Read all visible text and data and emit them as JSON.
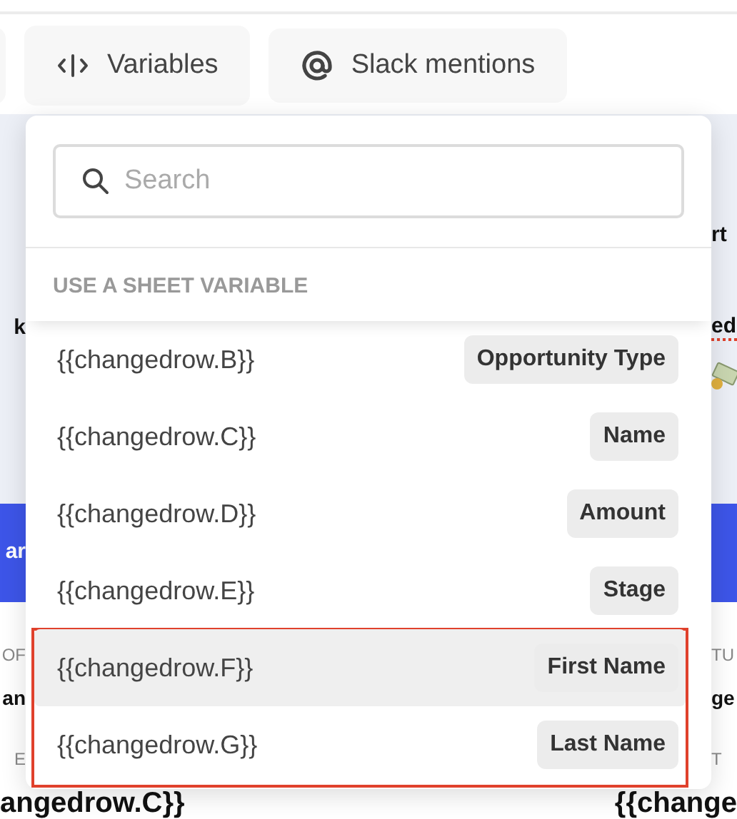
{
  "toolbar": {
    "buttons": [
      {
        "label": "Variables",
        "kind": "code"
      },
      {
        "label": "Slack mentions",
        "kind": "mention"
      }
    ]
  },
  "backdrop": {
    "rows": [
      {
        "kind": "heading",
        "left": "",
        "right": "rt"
      },
      {
        "kind": "heading",
        "left": "k",
        "right": "ed"
      },
      {
        "kind": "image",
        "left": "",
        "right": ""
      },
      {
        "kind": "band",
        "left": "ar",
        "right": ""
      },
      {
        "kind": "label",
        "left": "OF",
        "right": "TU"
      },
      {
        "kind": "value",
        "left": "an",
        "right": "ge"
      },
      {
        "kind": "label",
        "left": "E",
        "right": "T"
      },
      {
        "kind": "footer",
        "left": "angedrow.C}}",
        "right": "{{change"
      }
    ]
  },
  "menu": {
    "search": {
      "placeholder": "Search"
    },
    "section_title": "USE A SHEET VARIABLE",
    "items": [
      {
        "variable": "{{changedrow.B}}",
        "column": "Opportunity Type",
        "selected": false
      },
      {
        "variable": "{{changedrow.C}}",
        "column": "Name",
        "selected": false
      },
      {
        "variable": "{{changedrow.D}}",
        "column": "Amount",
        "selected": false
      },
      {
        "variable": "{{changedrow.E}}",
        "column": "Stage",
        "selected": false
      },
      {
        "variable": "{{changedrow.F}}",
        "column": "First Name",
        "selected": true
      },
      {
        "variable": "{{changedrow.G}}",
        "column": "Last Name",
        "selected": false
      }
    ]
  }
}
